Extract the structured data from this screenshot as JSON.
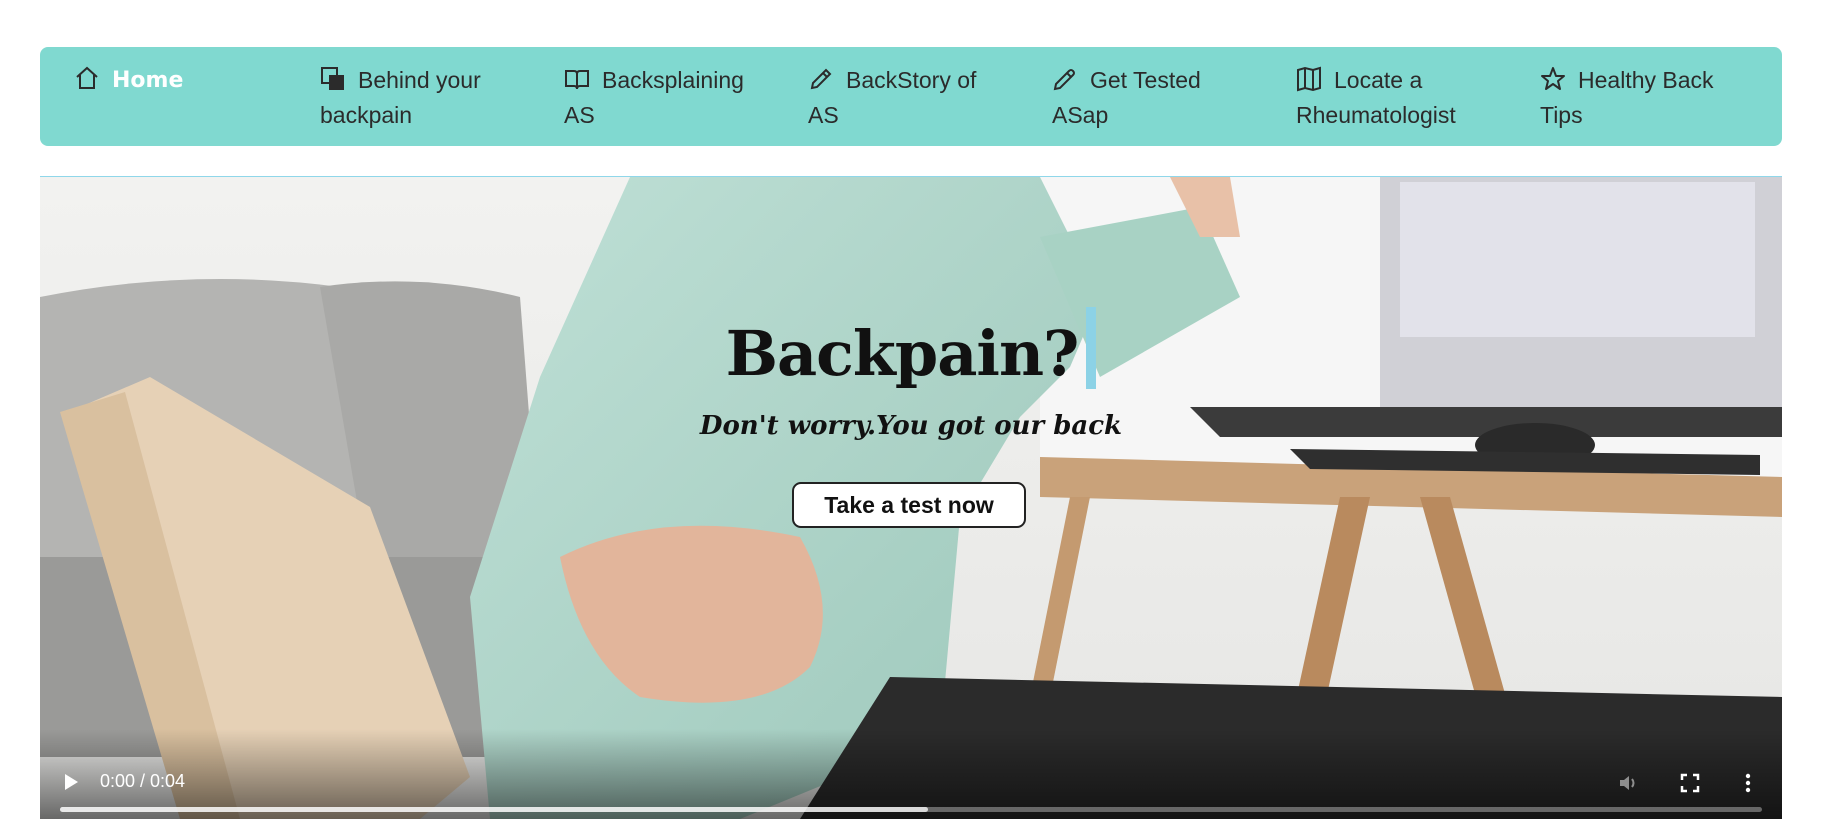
{
  "nav": {
    "items": [
      {
        "label": "Home",
        "icon": "home-icon"
      },
      {
        "label": "Behind your backpain",
        "icon": "stacked-squares-icon"
      },
      {
        "label": "Backsplaining AS",
        "icon": "open-book-icon"
      },
      {
        "label": "BackStory of AS",
        "icon": "pencil-icon"
      },
      {
        "label": "Get Tested ASap",
        "icon": "pen-icon"
      },
      {
        "label": "Locate a Rheumatologist",
        "icon": "map-icon"
      },
      {
        "label": "Healthy Back Tips",
        "icon": "star-icon"
      }
    ]
  },
  "hero": {
    "title": "Backpain?",
    "subtitle": "Don't worry.You got our back",
    "cta_label": "Take a test now"
  },
  "video": {
    "time_display": "0:00 / 0:04",
    "progress": 0.51
  },
  "colors": {
    "nav_bg": "#80d9d0",
    "caret": "#8cd2e6"
  }
}
